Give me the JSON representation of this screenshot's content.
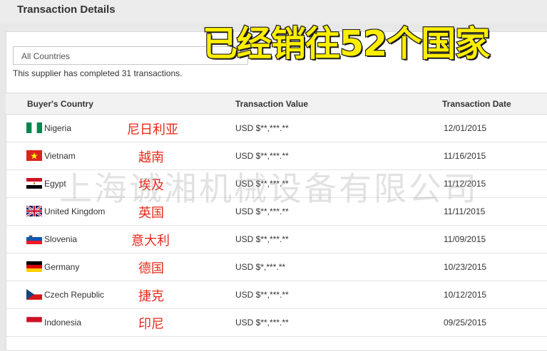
{
  "header": {
    "title": "Transaction Details"
  },
  "filter": {
    "selected": "All Countries"
  },
  "summary": {
    "prefix": "This supplier has completed ",
    "count": "31",
    "suffix": " transactions."
  },
  "banner": {
    "text": "已经销往52个国家",
    "color": "#ffee00"
  },
  "table": {
    "columns": [
      "Buyer's Country",
      "Transaction Value",
      "Transaction Date"
    ],
    "rows": [
      {
        "country": "Nigeria",
        "cn": "尼日利亚",
        "value": "USD $**,***.**",
        "date": "12/01/2015",
        "flag": "nigeria-flag"
      },
      {
        "country": "Vietnam",
        "cn": "越南",
        "value": "USD $**,***.**",
        "date": "11/16/2015",
        "flag": "vietnam-flag"
      },
      {
        "country": "Egypt",
        "cn": "埃及",
        "value": "USD $**,***.**",
        "date": "11/12/2015",
        "flag": "egypt-flag"
      },
      {
        "country": "United Kingdom",
        "cn": "英国",
        "value": "USD $**,***.**",
        "date": "11/11/2015",
        "flag": "uk-flag"
      },
      {
        "country": "Slovenia",
        "cn": "意大利",
        "value": "USD $**,***.**",
        "date": "11/09/2015",
        "flag": "slovenia-flag"
      },
      {
        "country": "Germany",
        "cn": "德国",
        "value": "USD $*,***.**",
        "date": "10/23/2015",
        "flag": "germany-flag"
      },
      {
        "country": "Czech Republic",
        "cn": "捷克",
        "value": "USD $**,***.**",
        "date": "10/12/2015",
        "flag": "czech-flag"
      },
      {
        "country": "Indonesia",
        "cn": "印尼",
        "value": "USD $**,***.**",
        "date": "09/25/2015",
        "flag": "indonesia-flag"
      }
    ]
  },
  "watermark": {
    "text": "上海诚湘机械设备有限公司"
  },
  "colors": {
    "annotation": "#e8291b",
    "header_bg": "#f2f2f2"
  }
}
